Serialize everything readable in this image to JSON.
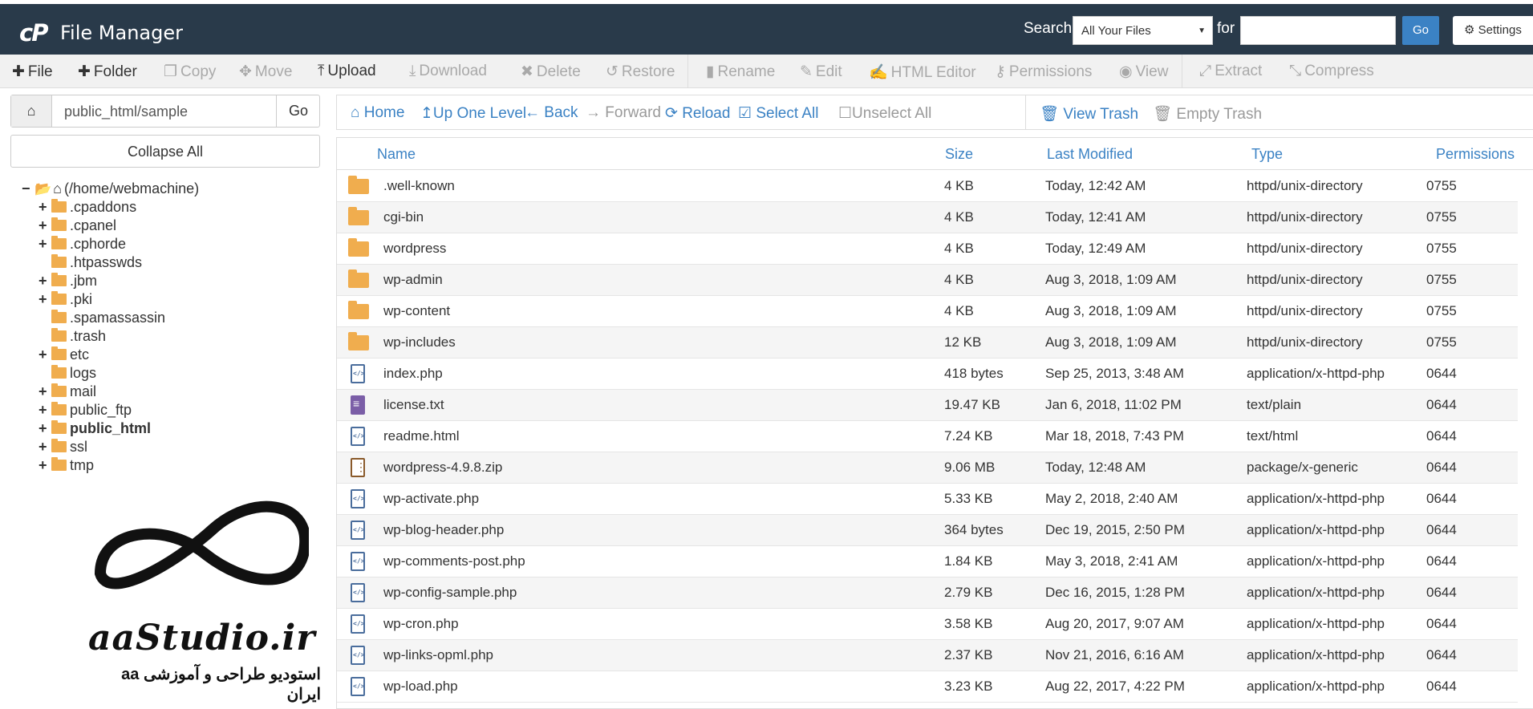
{
  "header": {
    "logo_text": "cP",
    "title": "File Manager",
    "search_label": "Search",
    "search_scope": "All Your Files",
    "for_label": "for",
    "search_value": "",
    "go_label": "Go",
    "settings_label": "Settings",
    "colors": {
      "header_bg": "#293a4a",
      "go_bg": "#3b82c4"
    }
  },
  "toolbar": {
    "items": [
      {
        "label": "File",
        "icon": "plus-icon",
        "enabled": true
      },
      {
        "label": "Folder",
        "icon": "plus-icon",
        "enabled": true
      },
      {
        "label": "Copy",
        "icon": "copy-icon",
        "enabled": false
      },
      {
        "label": "Move",
        "icon": "move-icon",
        "enabled": false
      },
      {
        "label": "Upload",
        "icon": "upload-icon",
        "enabled": true
      },
      {
        "label": "Download",
        "icon": "download-icon",
        "enabled": false
      },
      {
        "label": "Delete",
        "icon": "times-icon",
        "enabled": false
      },
      {
        "label": "Restore",
        "icon": "undo-icon",
        "enabled": false
      },
      {
        "label": "Rename",
        "icon": "file-icon",
        "enabled": false
      },
      {
        "label": "Edit",
        "icon": "pencil-icon",
        "enabled": false
      },
      {
        "label": "HTML Editor",
        "icon": "edit-icon",
        "enabled": false
      },
      {
        "label": "Permissions",
        "icon": "key-icon",
        "enabled": false
      },
      {
        "label": "View",
        "icon": "eye-icon",
        "enabled": false
      },
      {
        "label": "Extract",
        "icon": "expand-icon",
        "enabled": false
      },
      {
        "label": "Compress",
        "icon": "compress-icon",
        "enabled": false
      }
    ]
  },
  "pathbar": {
    "value": "public_html/sample",
    "go_label": "Go",
    "collapse_label": "Collapse All"
  },
  "tree": {
    "root_label": "(/home/webmachine)",
    "items": [
      {
        "label": ".cpaddons",
        "expandable": true
      },
      {
        "label": ".cpanel",
        "expandable": true
      },
      {
        "label": ".cphorde",
        "expandable": true
      },
      {
        "label": ".htpasswds",
        "expandable": false
      },
      {
        "label": ".jbm",
        "expandable": true
      },
      {
        "label": ".pki",
        "expandable": true
      },
      {
        "label": ".spamassassin",
        "expandable": false
      },
      {
        "label": ".trash",
        "expandable": false
      },
      {
        "label": "etc",
        "expandable": true
      },
      {
        "label": "logs",
        "expandable": false
      },
      {
        "label": "mail",
        "expandable": true
      },
      {
        "label": "public_ftp",
        "expandable": true
      },
      {
        "label": "public_html",
        "expandable": true,
        "bold": true
      },
      {
        "label": "ssl",
        "expandable": true
      },
      {
        "label": "tmp",
        "expandable": true
      }
    ]
  },
  "watermark": {
    "brand": "aaStudio.ir",
    "tagline": "استودیو طراحی و آموزشی aa ایران"
  },
  "actions": {
    "items": [
      {
        "label": "Home",
        "icon": "home-icon",
        "enabled": true
      },
      {
        "label": "Up One Level",
        "icon": "level-up-icon",
        "enabled": true
      },
      {
        "label": "Back",
        "icon": "arrow-left-icon",
        "enabled": true
      },
      {
        "label": "Forward",
        "icon": "arrow-right-icon",
        "enabled": false
      },
      {
        "label": "Reload",
        "icon": "refresh-icon",
        "enabled": true
      },
      {
        "label": "Select All",
        "icon": "check-square-icon",
        "enabled": true
      },
      {
        "label": "Unselect All",
        "icon": "square-icon",
        "enabled": false
      },
      {
        "label": "View Trash",
        "icon": "trash-icon",
        "enabled": true
      },
      {
        "label": "Empty Trash",
        "icon": "trash-icon",
        "enabled": false
      }
    ]
  },
  "table": {
    "columns": [
      "Name",
      "Size",
      "Last Modified",
      "Type",
      "Permissions"
    ],
    "rows": [
      {
        "icon": "folder-icon",
        "name": ".well-known",
        "size": "4 KB",
        "modified": "Today, 12:42 AM",
        "type": "httpd/unix-directory",
        "perms": "0755"
      },
      {
        "icon": "folder-icon",
        "name": "cgi-bin",
        "size": "4 KB",
        "modified": "Today, 12:41 AM",
        "type": "httpd/unix-directory",
        "perms": "0755"
      },
      {
        "icon": "folder-icon",
        "name": "wordpress",
        "size": "4 KB",
        "modified": "Today, 12:49 AM",
        "type": "httpd/unix-directory",
        "perms": "0755"
      },
      {
        "icon": "folder-icon",
        "name": "wp-admin",
        "size": "4 KB",
        "modified": "Aug 3, 2018, 1:09 AM",
        "type": "httpd/unix-directory",
        "perms": "0755"
      },
      {
        "icon": "folder-icon",
        "name": "wp-content",
        "size": "4 KB",
        "modified": "Aug 3, 2018, 1:09 AM",
        "type": "httpd/unix-directory",
        "perms": "0755"
      },
      {
        "icon": "folder-icon",
        "name": "wp-includes",
        "size": "12 KB",
        "modified": "Aug 3, 2018, 1:09 AM",
        "type": "httpd/unix-directory",
        "perms": "0755"
      },
      {
        "icon": "code-file-icon",
        "name": "index.php",
        "size": "418 bytes",
        "modified": "Sep 25, 2013, 3:48 AM",
        "type": "application/x-httpd-php",
        "perms": "0644"
      },
      {
        "icon": "text-file-icon",
        "name": "license.txt",
        "size": "19.47 KB",
        "modified": "Jan 6, 2018, 11:02 PM",
        "type": "text/plain",
        "perms": "0644"
      },
      {
        "icon": "code-file-icon",
        "name": "readme.html",
        "size": "7.24 KB",
        "modified": "Mar 18, 2018, 7:43 PM",
        "type": "text/html",
        "perms": "0644"
      },
      {
        "icon": "zip-file-icon",
        "name": "wordpress-4.9.8.zip",
        "size": "9.06 MB",
        "modified": "Today, 12:48 AM",
        "type": "package/x-generic",
        "perms": "0644"
      },
      {
        "icon": "code-file-icon",
        "name": "wp-activate.php",
        "size": "5.33 KB",
        "modified": "May 2, 2018, 2:40 AM",
        "type": "application/x-httpd-php",
        "perms": "0644"
      },
      {
        "icon": "code-file-icon",
        "name": "wp-blog-header.php",
        "size": "364 bytes",
        "modified": "Dec 19, 2015, 2:50 PM",
        "type": "application/x-httpd-php",
        "perms": "0644"
      },
      {
        "icon": "code-file-icon",
        "name": "wp-comments-post.php",
        "size": "1.84 KB",
        "modified": "May 3, 2018, 2:41 AM",
        "type": "application/x-httpd-php",
        "perms": "0644"
      },
      {
        "icon": "code-file-icon",
        "name": "wp-config-sample.php",
        "size": "2.79 KB",
        "modified": "Dec 16, 2015, 1:28 PM",
        "type": "application/x-httpd-php",
        "perms": "0644"
      },
      {
        "icon": "code-file-icon",
        "name": "wp-cron.php",
        "size": "3.58 KB",
        "modified": "Aug 20, 2017, 9:07 AM",
        "type": "application/x-httpd-php",
        "perms": "0644"
      },
      {
        "icon": "code-file-icon",
        "name": "wp-links-opml.php",
        "size": "2.37 KB",
        "modified": "Nov 21, 2016, 6:16 AM",
        "type": "application/x-httpd-php",
        "perms": "0644"
      },
      {
        "icon": "code-file-icon",
        "name": "wp-load.php",
        "size": "3.23 KB",
        "modified": "Aug 22, 2017, 4:22 PM",
        "type": "application/x-httpd-php",
        "perms": "0644"
      }
    ]
  }
}
